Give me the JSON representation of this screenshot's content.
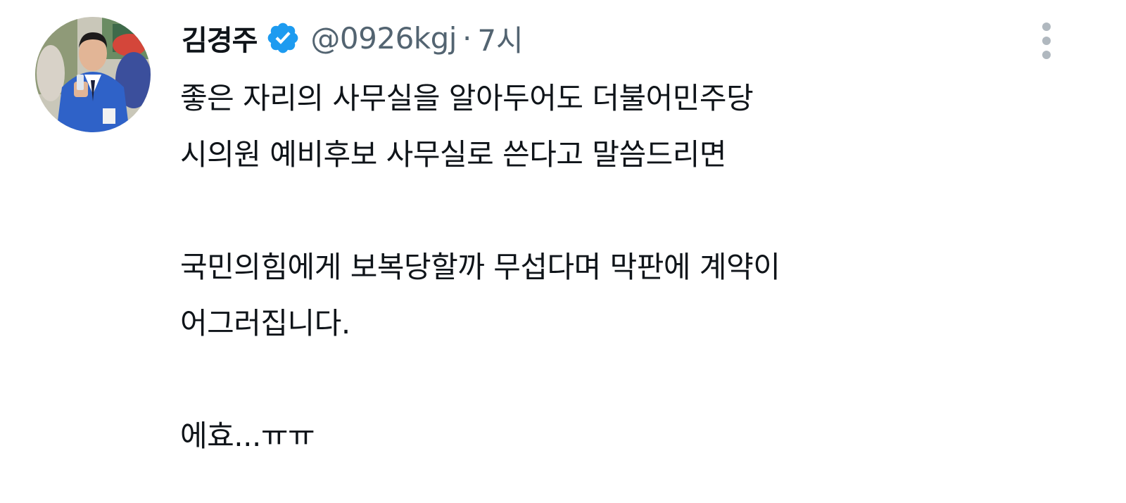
{
  "author": {
    "display_name": "김경주",
    "handle": "@0926kgj",
    "separator": "·",
    "timestamp": "7시",
    "verified_icon": "verified-badge-icon",
    "avatar_icon": "profile-photo"
  },
  "menu": {
    "icon": "more-vertical-icon"
  },
  "tweet": {
    "lines": [
      "좋은 자리의 사무실을 알아두어도 더불어민주당",
      "시의원 예비후보 사무실로 쓴다고 말씀드리면",
      "국민의힘에게 보복당할까 무섭다며 막판에 계약이",
      "어그러집니다.",
      "에효...ㅠㅠ"
    ]
  },
  "colors": {
    "text": "#0f1419",
    "secondary": "#536471",
    "verified": "#1d9bf0",
    "menu_dots": "#b0b8bf"
  }
}
